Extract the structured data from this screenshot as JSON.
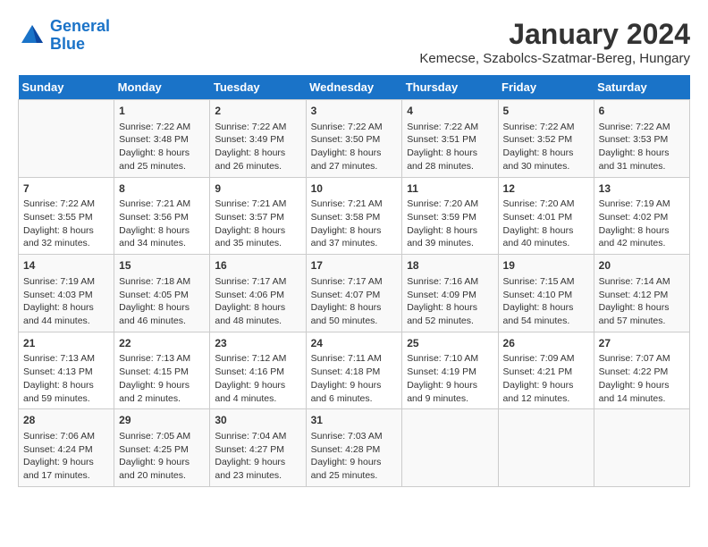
{
  "logo": {
    "line1": "General",
    "line2": "Blue"
  },
  "title": "January 2024",
  "location": "Kemecse, Szabolcs-Szatmar-Bereg, Hungary",
  "weekdays": [
    "Sunday",
    "Monday",
    "Tuesday",
    "Wednesday",
    "Thursday",
    "Friday",
    "Saturday"
  ],
  "weeks": [
    [
      {
        "day": "",
        "info": ""
      },
      {
        "day": "1",
        "info": "Sunrise: 7:22 AM\nSunset: 3:48 PM\nDaylight: 8 hours\nand 25 minutes."
      },
      {
        "day": "2",
        "info": "Sunrise: 7:22 AM\nSunset: 3:49 PM\nDaylight: 8 hours\nand 26 minutes."
      },
      {
        "day": "3",
        "info": "Sunrise: 7:22 AM\nSunset: 3:50 PM\nDaylight: 8 hours\nand 27 minutes."
      },
      {
        "day": "4",
        "info": "Sunrise: 7:22 AM\nSunset: 3:51 PM\nDaylight: 8 hours\nand 28 minutes."
      },
      {
        "day": "5",
        "info": "Sunrise: 7:22 AM\nSunset: 3:52 PM\nDaylight: 8 hours\nand 30 minutes."
      },
      {
        "day": "6",
        "info": "Sunrise: 7:22 AM\nSunset: 3:53 PM\nDaylight: 8 hours\nand 31 minutes."
      }
    ],
    [
      {
        "day": "7",
        "info": "Sunrise: 7:22 AM\nSunset: 3:55 PM\nDaylight: 8 hours\nand 32 minutes."
      },
      {
        "day": "8",
        "info": "Sunrise: 7:21 AM\nSunset: 3:56 PM\nDaylight: 8 hours\nand 34 minutes."
      },
      {
        "day": "9",
        "info": "Sunrise: 7:21 AM\nSunset: 3:57 PM\nDaylight: 8 hours\nand 35 minutes."
      },
      {
        "day": "10",
        "info": "Sunrise: 7:21 AM\nSunset: 3:58 PM\nDaylight: 8 hours\nand 37 minutes."
      },
      {
        "day": "11",
        "info": "Sunrise: 7:20 AM\nSunset: 3:59 PM\nDaylight: 8 hours\nand 39 minutes."
      },
      {
        "day": "12",
        "info": "Sunrise: 7:20 AM\nSunset: 4:01 PM\nDaylight: 8 hours\nand 40 minutes."
      },
      {
        "day": "13",
        "info": "Sunrise: 7:19 AM\nSunset: 4:02 PM\nDaylight: 8 hours\nand 42 minutes."
      }
    ],
    [
      {
        "day": "14",
        "info": "Sunrise: 7:19 AM\nSunset: 4:03 PM\nDaylight: 8 hours\nand 44 minutes."
      },
      {
        "day": "15",
        "info": "Sunrise: 7:18 AM\nSunset: 4:05 PM\nDaylight: 8 hours\nand 46 minutes."
      },
      {
        "day": "16",
        "info": "Sunrise: 7:17 AM\nSunset: 4:06 PM\nDaylight: 8 hours\nand 48 minutes."
      },
      {
        "day": "17",
        "info": "Sunrise: 7:17 AM\nSunset: 4:07 PM\nDaylight: 8 hours\nand 50 minutes."
      },
      {
        "day": "18",
        "info": "Sunrise: 7:16 AM\nSunset: 4:09 PM\nDaylight: 8 hours\nand 52 minutes."
      },
      {
        "day": "19",
        "info": "Sunrise: 7:15 AM\nSunset: 4:10 PM\nDaylight: 8 hours\nand 54 minutes."
      },
      {
        "day": "20",
        "info": "Sunrise: 7:14 AM\nSunset: 4:12 PM\nDaylight: 8 hours\nand 57 minutes."
      }
    ],
    [
      {
        "day": "21",
        "info": "Sunrise: 7:13 AM\nSunset: 4:13 PM\nDaylight: 8 hours\nand 59 minutes."
      },
      {
        "day": "22",
        "info": "Sunrise: 7:13 AM\nSunset: 4:15 PM\nDaylight: 9 hours\nand 2 minutes."
      },
      {
        "day": "23",
        "info": "Sunrise: 7:12 AM\nSunset: 4:16 PM\nDaylight: 9 hours\nand 4 minutes."
      },
      {
        "day": "24",
        "info": "Sunrise: 7:11 AM\nSunset: 4:18 PM\nDaylight: 9 hours\nand 6 minutes."
      },
      {
        "day": "25",
        "info": "Sunrise: 7:10 AM\nSunset: 4:19 PM\nDaylight: 9 hours\nand 9 minutes."
      },
      {
        "day": "26",
        "info": "Sunrise: 7:09 AM\nSunset: 4:21 PM\nDaylight: 9 hours\nand 12 minutes."
      },
      {
        "day": "27",
        "info": "Sunrise: 7:07 AM\nSunset: 4:22 PM\nDaylight: 9 hours\nand 14 minutes."
      }
    ],
    [
      {
        "day": "28",
        "info": "Sunrise: 7:06 AM\nSunset: 4:24 PM\nDaylight: 9 hours\nand 17 minutes."
      },
      {
        "day": "29",
        "info": "Sunrise: 7:05 AM\nSunset: 4:25 PM\nDaylight: 9 hours\nand 20 minutes."
      },
      {
        "day": "30",
        "info": "Sunrise: 7:04 AM\nSunset: 4:27 PM\nDaylight: 9 hours\nand 23 minutes."
      },
      {
        "day": "31",
        "info": "Sunrise: 7:03 AM\nSunset: 4:28 PM\nDaylight: 9 hours\nand 25 minutes."
      },
      {
        "day": "",
        "info": ""
      },
      {
        "day": "",
        "info": ""
      },
      {
        "day": "",
        "info": ""
      }
    ]
  ]
}
